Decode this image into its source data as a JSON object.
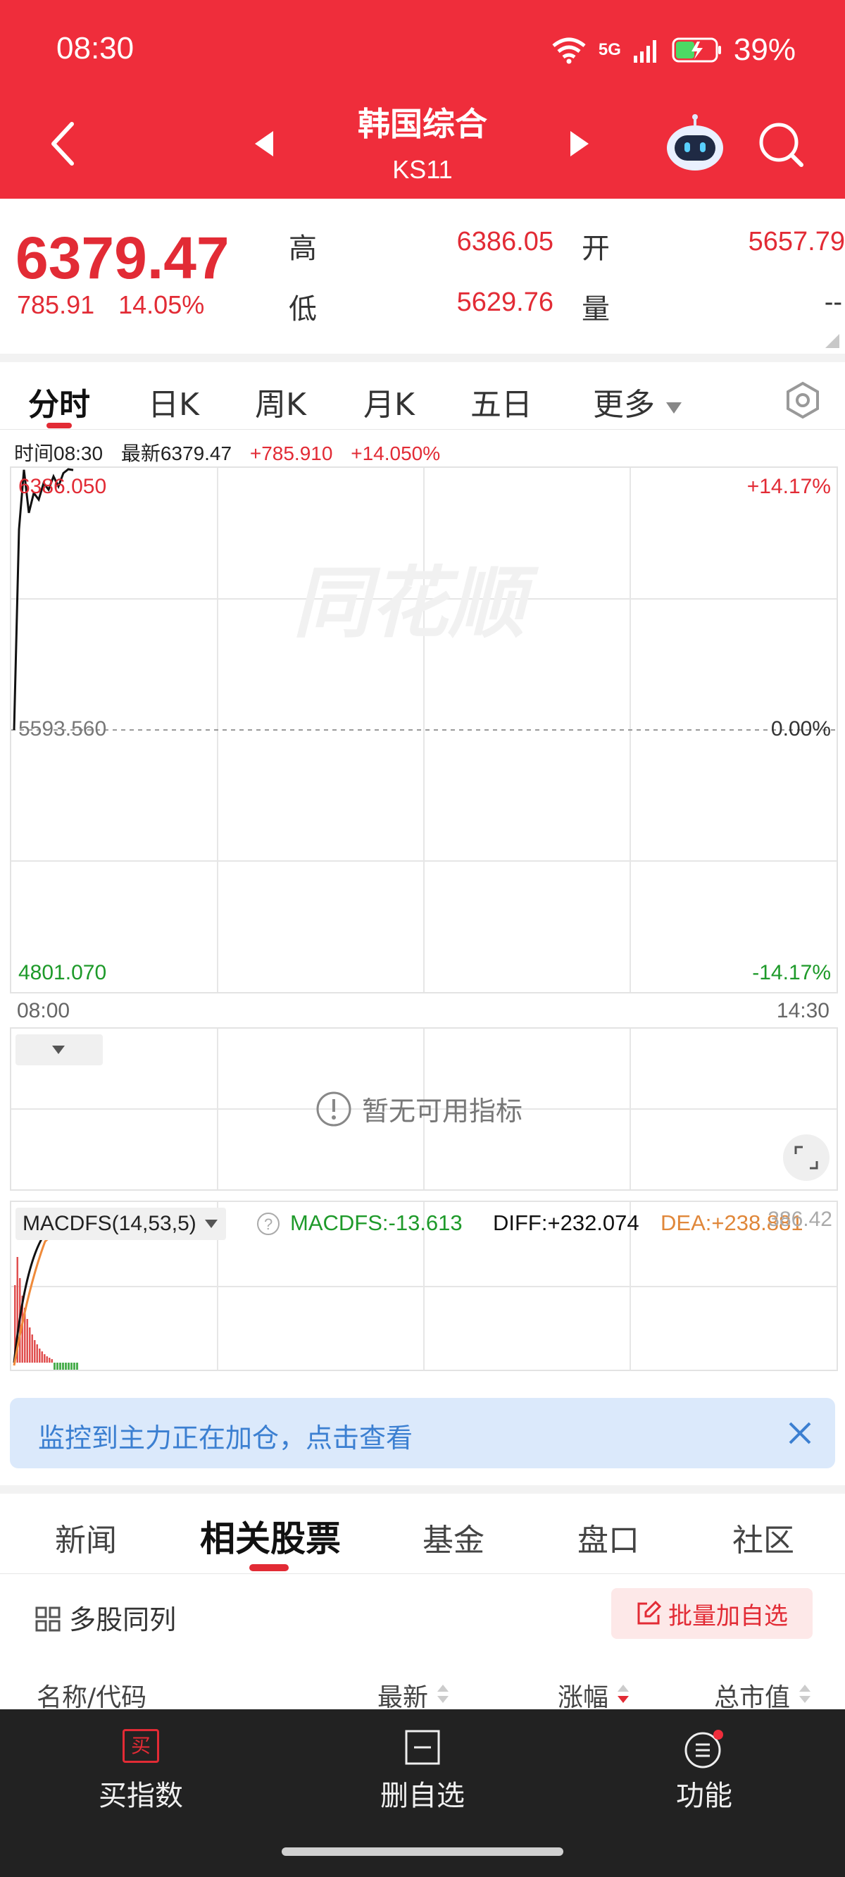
{
  "status_bar": {
    "time": "08:30",
    "network": "5G",
    "battery": "39%"
  },
  "header": {
    "title": "韩国综合",
    "code": "KS11"
  },
  "quote": {
    "price": "6379.47",
    "change": "785.91",
    "change_pct": "14.05%",
    "high_label": "高",
    "high": "6386.05",
    "open_label": "开",
    "open": "5657.79",
    "low_label": "低",
    "low": "5629.76",
    "volume_label": "量",
    "volume": "--"
  },
  "period_tabs": [
    "分时",
    "日K",
    "周K",
    "月K",
    "五日",
    "更多"
  ],
  "chart_info": {
    "time": "时间08:30",
    "latest": "最新6379.47",
    "change": "+785.910",
    "change_pct": "+14.050%"
  },
  "chart_data": {
    "type": "line",
    "y_top": "6386.050",
    "y_mid": "5593.560",
    "y_bottom": "4801.070",
    "pct_top": "+14.17%",
    "pct_mid": "0.00%",
    "pct_bottom": "-14.17%",
    "x_start": "08:00",
    "x_end": "14:30",
    "ylim": [
      4801.07,
      6386.05
    ],
    "x": [
      0,
      1,
      2,
      3,
      4,
      5,
      6,
      7,
      8,
      9,
      10,
      11,
      12
    ],
    "y": [
      5593.56,
      6200.0,
      6380.0,
      6250.0,
      6310.0,
      6290.0,
      6340.0,
      6320.0,
      6360.0,
      6330.0,
      6370.0,
      6386.05,
      6379.47
    ]
  },
  "indicator": {
    "empty_text": "暂无可用指标"
  },
  "macd": {
    "name": "MACDFS(14,53,5)",
    "macdfs": "MACDFS:-13.613",
    "diff": "DIFF:+232.074",
    "dea": "DEA:+238.881",
    "right_value": "386.42"
  },
  "banner": {
    "text": "监控到主力正在加仓，点击查看"
  },
  "bottom_tabs": [
    "新闻",
    "相关股票",
    "基金",
    "盘口",
    "社区"
  ],
  "related": {
    "multi_label": "多股同列",
    "batch_label": "批量加自选",
    "columns": [
      "名称/代码",
      "最新",
      "涨幅",
      "总市值"
    ]
  },
  "nav": {
    "buy": "买指数",
    "remove": "删自选",
    "func": "功能",
    "buy_icon_char": "买"
  },
  "colors": {
    "brand": "#ef2d3b",
    "up": "#e22b35",
    "down": "#1e9a2a"
  }
}
